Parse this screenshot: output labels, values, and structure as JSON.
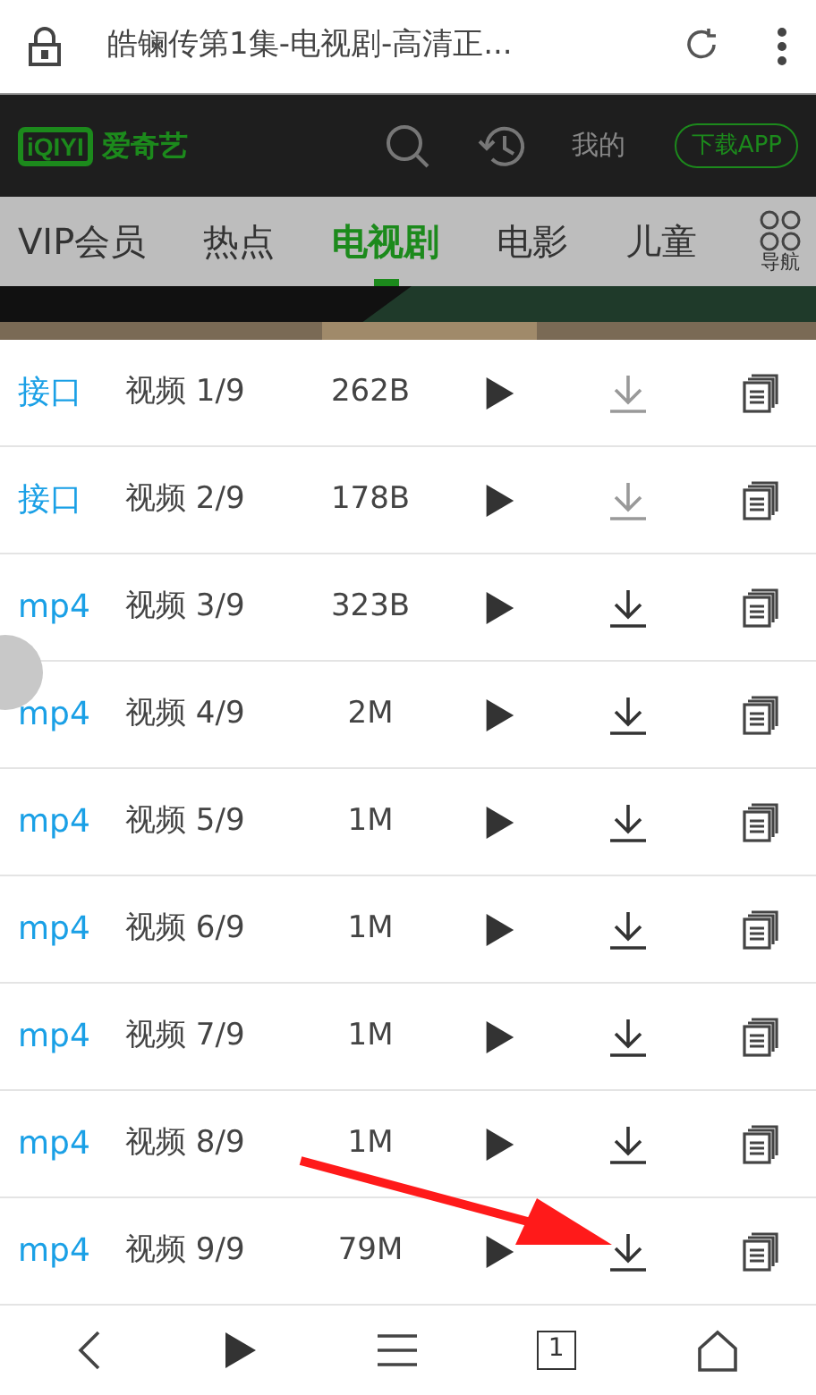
{
  "address_bar": {
    "title": "皓镧传第1集-电视剧-高清正..."
  },
  "site_header": {
    "logo_text": "爱奇艺",
    "logo_mark": "iQIYI",
    "account_link": "我的",
    "download_button": "下载APP"
  },
  "nav_tabs": [
    {
      "label": "VIP会员",
      "selected": false
    },
    {
      "label": "热点",
      "selected": false
    },
    {
      "label": "电视剧",
      "selected": true
    },
    {
      "label": "电影",
      "selected": false
    },
    {
      "label": "儿童",
      "selected": false
    }
  ],
  "nav_more": {
    "label": "导航"
  },
  "videos": [
    {
      "source": "接口",
      "name": "视频 1/9",
      "size": "262B",
      "download_disabled": true
    },
    {
      "source": "接口",
      "name": "视频 2/9",
      "size": "178B",
      "download_disabled": true
    },
    {
      "source": "mp4",
      "name": "视频 3/9",
      "size": "323B",
      "download_disabled": false
    },
    {
      "source": "mp4",
      "name": "视频 4/9",
      "size": "2M",
      "download_disabled": false
    },
    {
      "source": "mp4",
      "name": "视频 5/9",
      "size": "1M",
      "download_disabled": false
    },
    {
      "source": "mp4",
      "name": "视频 6/9",
      "size": "1M",
      "download_disabled": false
    },
    {
      "source": "mp4",
      "name": "视频 7/9",
      "size": "1M",
      "download_disabled": false
    },
    {
      "source": "mp4",
      "name": "视频 8/9",
      "size": "1M",
      "download_disabled": false
    },
    {
      "source": "mp4",
      "name": "视频 9/9",
      "size": "79M",
      "download_disabled": false
    }
  ],
  "bottom_bar": {
    "tab_count": "1"
  }
}
